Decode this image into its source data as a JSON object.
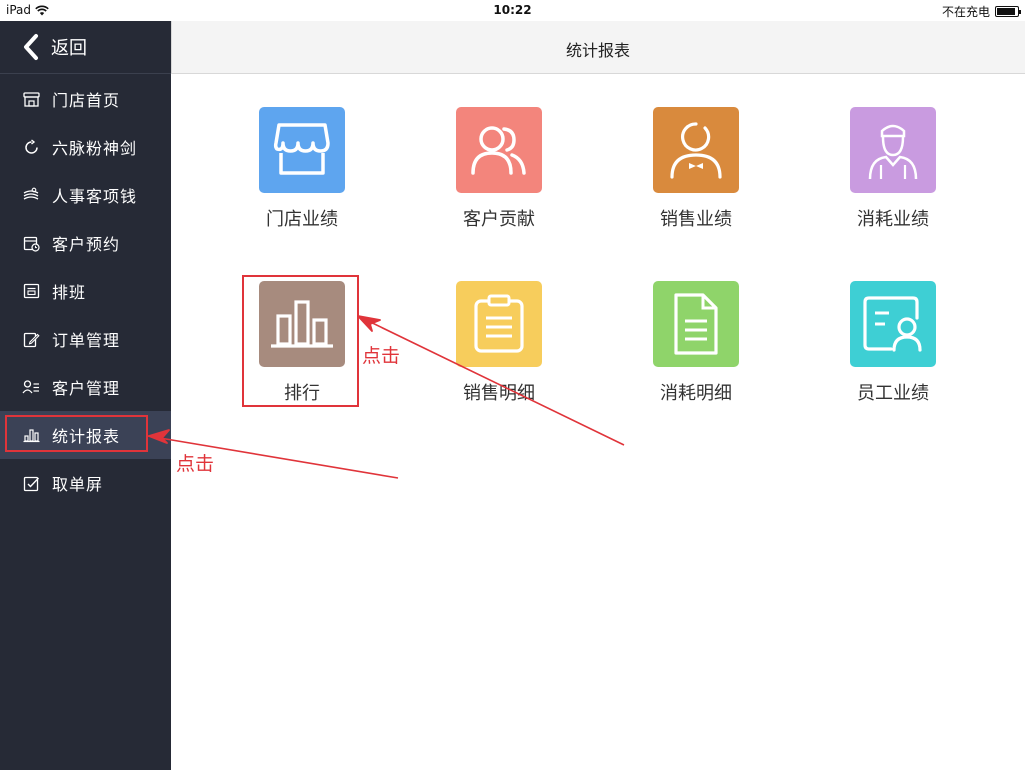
{
  "status_bar": {
    "device": "iPad",
    "time": "10:22",
    "charging_text": "不在充电"
  },
  "sidebar": {
    "back_label": "返回",
    "items": [
      {
        "label": "门店首页",
        "icon": "storefront-icon"
      },
      {
        "label": "六脉粉神剑",
        "icon": "refresh-circle-icon"
      },
      {
        "label": "人事客项钱",
        "icon": "layers-icon"
      },
      {
        "label": "客户预约",
        "icon": "calendar-clock-icon"
      },
      {
        "label": "排班",
        "icon": "schedule-board-icon"
      },
      {
        "label": "订单管理",
        "icon": "edit-document-icon"
      },
      {
        "label": "客户管理",
        "icon": "user-list-icon"
      },
      {
        "label": "统计报表",
        "icon": "bar-chart-icon",
        "active": true
      },
      {
        "label": "取单屏",
        "icon": "checkbox-icon"
      }
    ]
  },
  "header": {
    "title": "统计报表"
  },
  "tiles": [
    {
      "label": "门店业绩",
      "icon": "store-awning-icon",
      "color": "#5ea5ef"
    },
    {
      "label": "客户贡献",
      "icon": "users-icon",
      "color": "#f3857c"
    },
    {
      "label": "销售业绩",
      "icon": "salesperson-icon",
      "color": "#d98a3d"
    },
    {
      "label": "消耗业绩",
      "icon": "worker-icon",
      "color": "#c99be0"
    },
    {
      "label": "排行",
      "icon": "ranking-bars-icon",
      "color": "#a78b7e"
    },
    {
      "label": "销售明细",
      "icon": "clipboard-icon",
      "color": "#f7cd5c"
    },
    {
      "label": "消耗明细",
      "icon": "document-icon",
      "color": "#8fd46a"
    },
    {
      "label": "员工业绩",
      "icon": "employee-card-icon",
      "color": "#3ecfd4"
    }
  ],
  "annotations": {
    "click_text_1": "点击",
    "click_text_2": "点击",
    "color": "#e0343a"
  }
}
